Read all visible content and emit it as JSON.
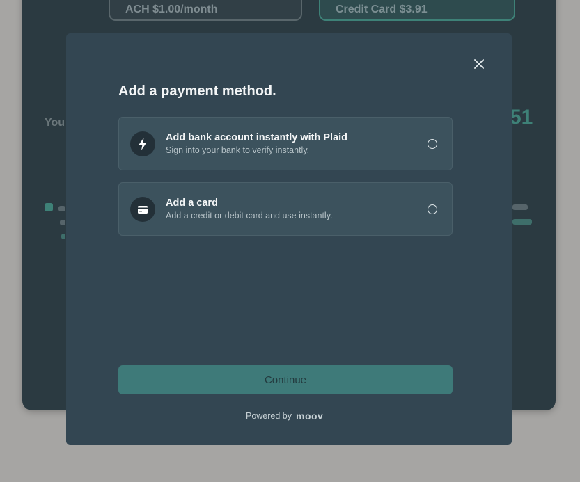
{
  "background": {
    "plans": [
      {
        "label": "ACH $1.00/month"
      },
      {
        "label": "Credit Card $3.91"
      }
    ],
    "left_text": "You",
    "right_text": "51"
  },
  "modal": {
    "title": "Add a payment method.",
    "close_icon": "close-icon",
    "options": [
      {
        "icon": "lightning-icon",
        "title": "Add bank account instantly with Plaid",
        "subtitle": "Sign into your bank to verify instantly.",
        "selected": false
      },
      {
        "icon": "credit-card-icon",
        "title": "Add a card",
        "subtitle": "Add a credit or debit card and use instantly.",
        "selected": false
      }
    ],
    "continue_label": "Continue",
    "powered_by": "Powered by",
    "brand": "moov"
  },
  "colors": {
    "modal_bg": "#334652",
    "option_bg": "#3c525d",
    "continue_bg": "#3e7a79",
    "accent": "#3e8177"
  }
}
